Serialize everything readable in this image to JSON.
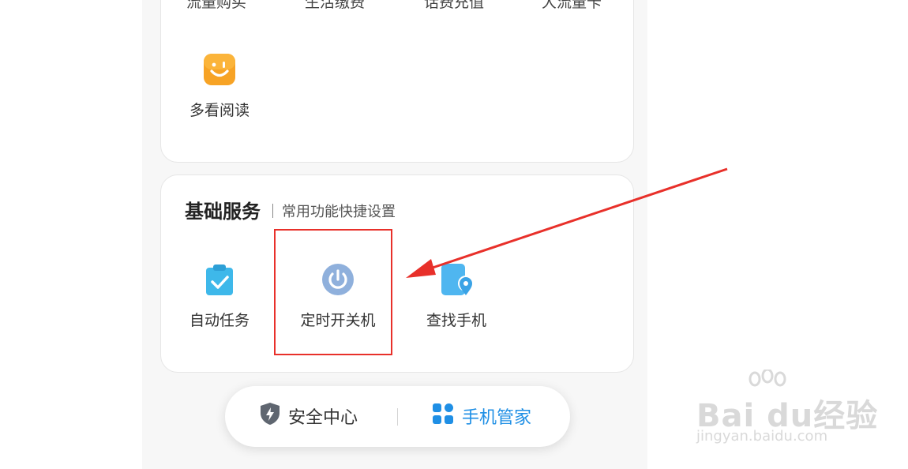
{
  "top_card": {
    "cut_labels": [
      "流量购买",
      "生活缴费",
      "话费充值",
      "大流量卡"
    ],
    "apps": [
      {
        "label": "多看阅读",
        "icon": "smiley-reading-icon"
      }
    ]
  },
  "basic_services": {
    "title": "基础服务",
    "subtitle": "常用功能快捷设置",
    "items": [
      {
        "label": "自动任务",
        "icon": "clipboard-check-icon"
      },
      {
        "label": "定时开关机",
        "icon": "power-icon"
      },
      {
        "label": "查找手机",
        "icon": "find-phone-location-icon"
      }
    ]
  },
  "bottom_nav": {
    "security_label": "安全中心",
    "manager_label": "手机管家"
  },
  "annotation": {
    "highlight_color": "#e8302a"
  },
  "watermark": {
    "brand": "Bai  du经验",
    "url": "jingyan.baidu.com"
  },
  "colors": {
    "accent_blue": "#1f8fe5",
    "app_orange": "#f7a325",
    "power_blue": "#8fb0dc"
  }
}
